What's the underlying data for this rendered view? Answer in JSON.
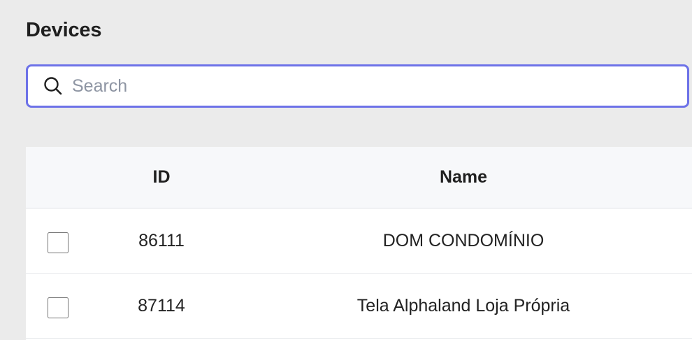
{
  "page": {
    "title": "Devices"
  },
  "search": {
    "placeholder": "Search",
    "value": "",
    "icon": "search-icon",
    "accent_color": "#6d72e8"
  },
  "table": {
    "columns": [
      {
        "label": ""
      },
      {
        "label": "ID"
      },
      {
        "label": "Name"
      }
    ],
    "rows": [
      {
        "selected": false,
        "id": "86111",
        "name": "DOM CONDOMÍNIO"
      },
      {
        "selected": false,
        "id": "87114",
        "name": "Tela Alphaland Loja Própria"
      }
    ]
  }
}
